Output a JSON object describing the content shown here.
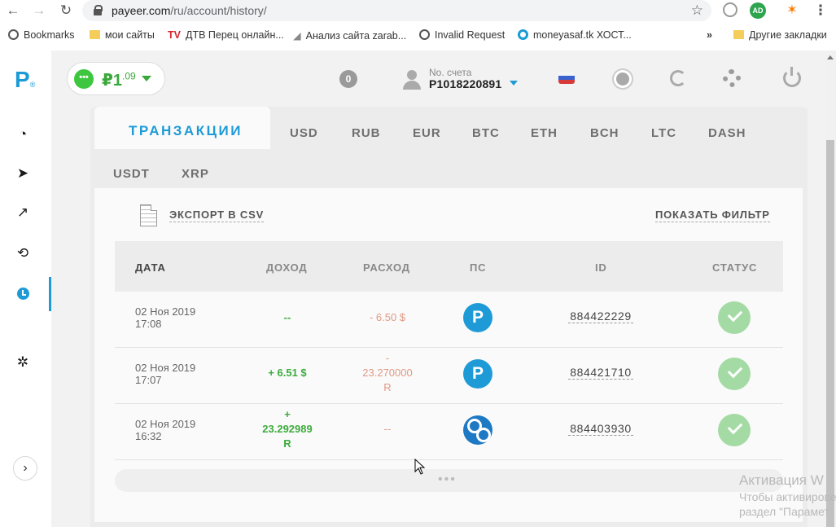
{
  "browser": {
    "url_domain": "payeer.com",
    "url_path": "/ru/account/history/",
    "bookmarks": [
      {
        "label": "Bookmarks",
        "icon": "globe-icon"
      },
      {
        "label": "мои сайты",
        "icon": "folder-icon"
      },
      {
        "label": "ДТВ Перец онлайн...",
        "icon": "tv-icon"
      },
      {
        "label": "Анализ сайта zarab...",
        "icon": "arrow-icon"
      },
      {
        "label": "Invalid Request",
        "icon": "globe-icon"
      },
      {
        "label": "moneyasaf.tk ХОСТ...",
        "icon": "ring-icon"
      },
      {
        "label": "Другие закладки",
        "icon": "folder-icon"
      }
    ],
    "overflow": "»",
    "ext_ad_label": "AD"
  },
  "sidebar": {
    "logo": "P",
    "logo_mark": "®",
    "items": [
      {
        "name": "dashboard",
        "icon": "speedometer-icon"
      },
      {
        "name": "send",
        "icon": "paper-plane-icon"
      },
      {
        "name": "charts",
        "icon": "chart-icon"
      },
      {
        "name": "exchange",
        "icon": "exchange-icon"
      },
      {
        "name": "history",
        "icon": "clock-icon",
        "active": true
      },
      {
        "name": "settings",
        "icon": "gears-icon"
      }
    ],
    "expand": "›"
  },
  "topbar": {
    "balance_currency": "₽",
    "balance_int": "1",
    "balance_frac": ".09",
    "notifications": "0",
    "account_label": "No. счета",
    "account_number": "P1018220891"
  },
  "tabs": {
    "active": "ТРАНЗАКЦИИ",
    "items": [
      "USD",
      "RUB",
      "EUR",
      "BTC",
      "ETH",
      "BCH",
      "LTC",
      "DASH",
      "USDT",
      "XRP"
    ]
  },
  "actions": {
    "export_csv": "ЭКСПОРТ В CSV",
    "show_filter": "ПОКАЗАТЬ ФИЛЬТР"
  },
  "table": {
    "headers": {
      "date": "ДАТА",
      "income": "ДОХОД",
      "expense": "РАСХОД",
      "ps": "ПС",
      "id": "ID",
      "status": "СТАТУС"
    },
    "rows": [
      {
        "date": "02 Ноя 2019",
        "time": "17:08",
        "income": [
          "--"
        ],
        "expense": [
          "- 6.50 $"
        ],
        "ps": "P",
        "ps_icon": "payeer-icon",
        "id": "884422229",
        "status": "success"
      },
      {
        "date": "02 Ноя 2019",
        "time": "17:07",
        "income": [
          "+ 6.51 $"
        ],
        "expense": [
          "-",
          "23.270000",
          "R"
        ],
        "ps": "P",
        "ps_icon": "payeer-icon",
        "id": "884421710",
        "status": "success"
      },
      {
        "date": "02 Ноя 2019",
        "time": "16:32",
        "income": [
          "+",
          "23.292989",
          "R"
        ],
        "expense": [
          "--"
        ],
        "ps": "",
        "ps_icon": "xrp-icon",
        "id": "884403930",
        "status": "success"
      }
    ]
  },
  "more": "•••",
  "watermark": {
    "line1": "Активация W",
    "line2": "Чтобы активирове",
    "line3": "раздел \"Парамет"
  },
  "colors": {
    "accent": "#1e9bd7",
    "income": "#3cac3c",
    "expense": "#e09a84",
    "status_ok": "#a4dba4"
  }
}
